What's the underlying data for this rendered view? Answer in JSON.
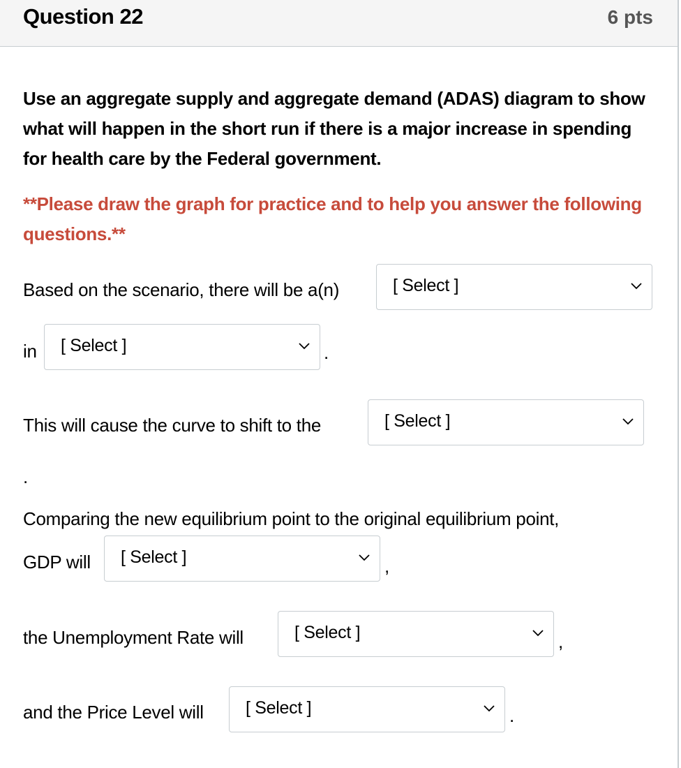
{
  "header": {
    "title": "Question 22",
    "points": "6 pts"
  },
  "prompt": "Use an aggregate supply and aggregate demand (ADAS) diagram to show what will happen in the short run if there is a major increase in spending for health care by the Federal government.",
  "note": "**Please draw the graph for practice and to help you answer the following questions.**",
  "colors": {
    "note": "#c74b3b",
    "header_bg": "#f5f5f5",
    "border": "#c7cdd1"
  },
  "lines": {
    "l1": "Based on the scenario, there will be a(n)",
    "l2": "in",
    "l2_end": ".",
    "l3": "This will cause the curve to shift to the",
    "l3_end": ".",
    "l4a": "Comparing the new equilibrium point to the original equilibrium point,",
    "l4b": "GDP will",
    "l4_end": ",",
    "l5": "the Unemployment Rate will",
    "l5_end": ",",
    "l6": "and the Price Level will",
    "l6_end": "."
  },
  "dropdowns": {
    "d1": "[ Select ]",
    "d2": "[ Select ]",
    "d3": "[ Select ]",
    "d4": "[ Select ]",
    "d5": "[ Select ]",
    "d6": "[ Select ]"
  },
  "icons": {
    "dropdown": "chevron-down-icon"
  }
}
